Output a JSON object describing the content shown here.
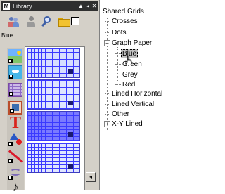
{
  "library": {
    "title": "Library",
    "title_icon_letter": "M",
    "controls": {
      "collapse": "▲",
      "prev": "◂",
      "close": "✕"
    },
    "selected_item_label": "Blue",
    "toolbar": {
      "menu_label": "..."
    },
    "thumbnails": [
      "blue-grid",
      "blue-grid",
      "blue-grid-dark",
      "blue-grid"
    ],
    "side_icons": [
      "scene-icon",
      "photo-icon",
      "grid-icon",
      "frame-icon",
      "text-icon",
      "shapes-icon",
      "line-icon",
      "wave-icon",
      "music-icon"
    ],
    "text_icon_glyph": "T",
    "music_icon_glyph": "♪",
    "scroll_arrow": "◂"
  },
  "tree": {
    "root": "Shared Grids",
    "items": [
      {
        "label": "Crosses"
      },
      {
        "label": "Dots"
      },
      {
        "label": "Graph Paper",
        "expanded": true,
        "toggle": "−"
      },
      {
        "label": "Blue",
        "selected": true
      },
      {
        "label": "Green"
      },
      {
        "label": "Grey"
      },
      {
        "label": "Red"
      },
      {
        "label": "Lined Horizontal"
      },
      {
        "label": "Lined Vertical"
      },
      {
        "label": "Other"
      },
      {
        "label": "X-Y Lined",
        "expanded": false,
        "toggle": "+"
      }
    ]
  },
  "colors": {
    "titlebar": "#2f2f2f",
    "panel": "#d4d0c8",
    "grid_line": "#3a3aff",
    "selection": "#c0c0c0"
  }
}
